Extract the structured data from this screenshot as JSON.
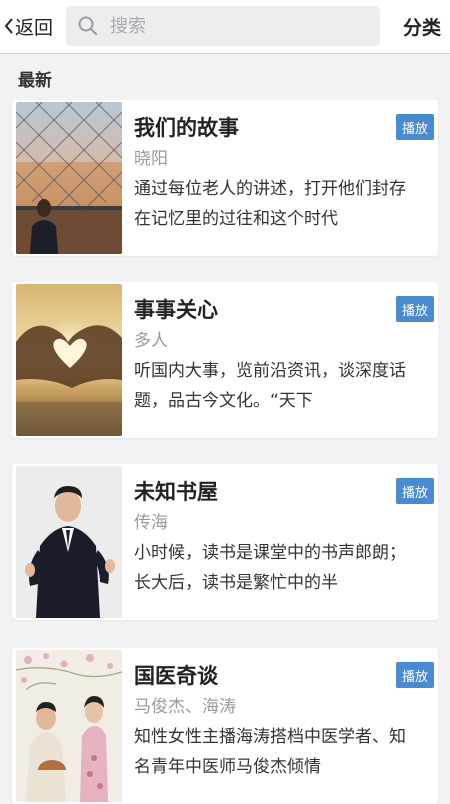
{
  "header": {
    "back_label": "返回",
    "search_placeholder": "搜索",
    "category_label": "分类"
  },
  "section": {
    "title": "最新"
  },
  "items": [
    {
      "title": "我们的故事",
      "author": "晓阳",
      "description": "通过每位老人的讲述，打开他们封存在记忆里的过往和这个时代",
      "play_label": "播放"
    },
    {
      "title": "事事关心",
      "author": "多人",
      "description": "听国内大事，览前沿资讯，谈深度话题，品古今文化。“天下",
      "play_label": "播放"
    },
    {
      "title": "未知书屋",
      "author": "传海",
      "description": "小时候，读书是课堂中的书声郎朗；长大后，读书是繁忙中的半",
      "play_label": "播放"
    },
    {
      "title": "国医奇谈",
      "author": "马俊杰、海涛",
      "description": "知性女性主播海涛搭档中医学者、知名青年中医师马俊杰倾情",
      "play_label": "播放"
    }
  ]
}
